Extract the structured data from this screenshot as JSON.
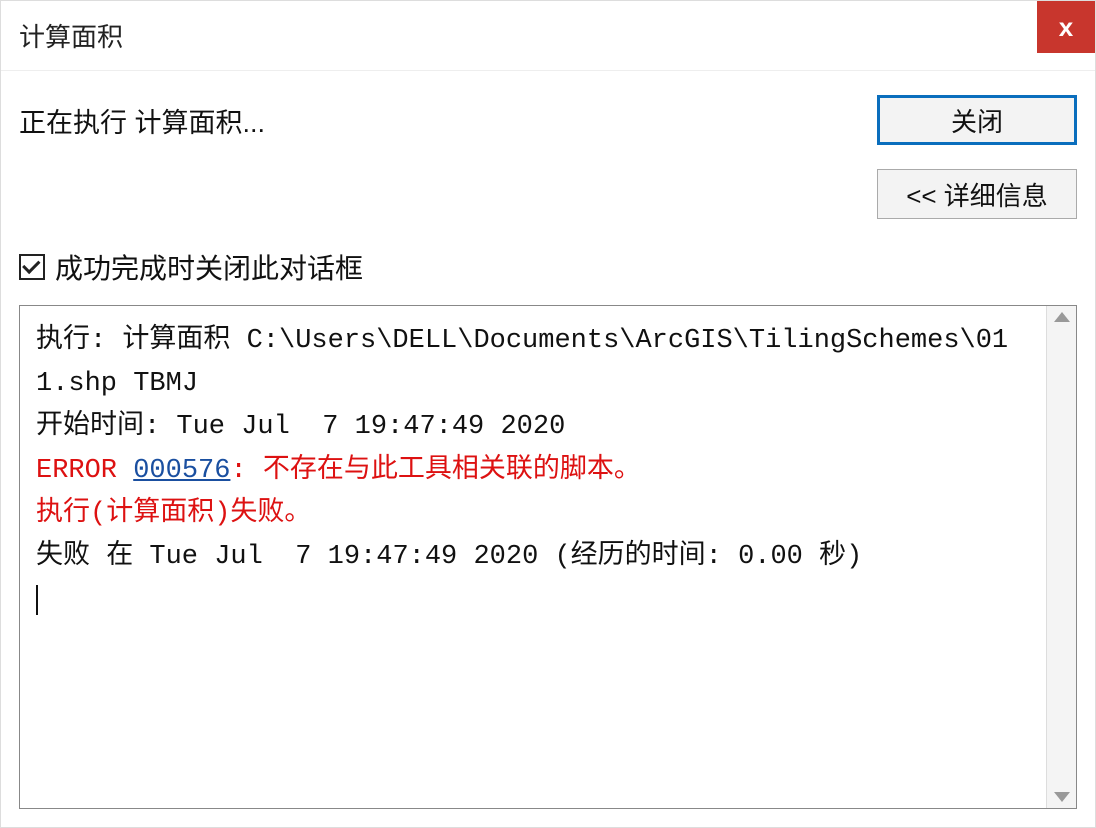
{
  "window": {
    "title": "计算面积",
    "close_icon_label": "x"
  },
  "status": {
    "running_text": "正在执行 计算面积..."
  },
  "buttons": {
    "close_label": "关闭",
    "details_label": "<< 详细信息"
  },
  "checkbox": {
    "checked": true,
    "label": "成功完成时关闭此对话框"
  },
  "log": {
    "line1": "执行: 计算面积 C:\\Users\\DELL\\Documents\\ArcGIS\\TilingSchemes\\011.shp TBMJ",
    "line2": "开始时间: Tue Jul  7 19:47:49 2020",
    "error_prefix": "ERROR ",
    "error_code": "000576",
    "error_suffix": ": 不存在与此工具相关联的脚本。",
    "fail_line": "执行(计算面积)失败。",
    "line5": "失败 在 Tue Jul  7 19:47:49 2020 (经历的时间: 0.00 秒)"
  }
}
